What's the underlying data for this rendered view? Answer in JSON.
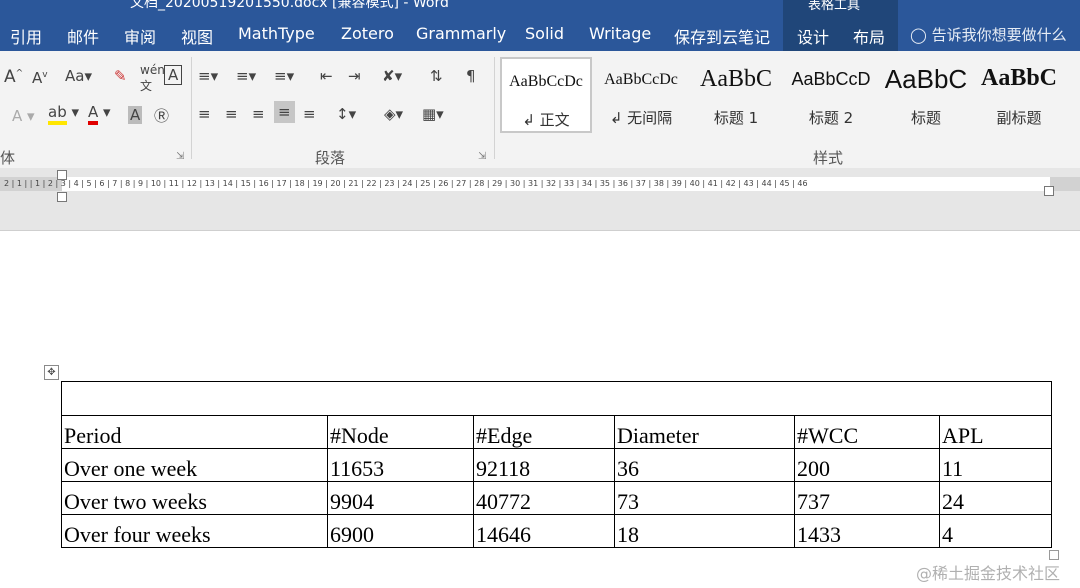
{
  "title_bar": {
    "document_title": "文档_20200519201550.docx [兼容模式] - Word",
    "context_tools": "表格工具"
  },
  "tabs": [
    "引用",
    "邮件",
    "审阅",
    "视图",
    "MathType",
    "Zotero",
    "Grammarly",
    "Solid",
    "Writage",
    "保存到云笔记",
    "设计",
    "布局"
  ],
  "tell_me": "告诉我你想要做什么",
  "ribbon": {
    "font_group_label": "体",
    "paragraph_group_label": "段落",
    "styles_group_label": "样式",
    "styles": [
      {
        "sample": "AaBbCcDc",
        "name": "↲ 正文",
        "selected": true
      },
      {
        "sample": "AaBbCcDc",
        "name": "↲ 无间隔"
      },
      {
        "sample": "AaBbC",
        "name": "标题 1"
      },
      {
        "sample": "AaBbCcD",
        "name": "标题 2"
      },
      {
        "sample": "AaBbC",
        "name": "标题"
      },
      {
        "sample": "AaBbC",
        "name": "副标题"
      }
    ]
  },
  "ruler_text": "2 | 1 |   | 1 | 2 | 3 | 4 | 5 | 6 | 7 | 8 | 9 | 10 | 11 | 12 | 13 | 14 | 15 | 16 | 17 | 18 | 19 | 20 | 21 | 22 | 23 | 24 | 25 | 26 | 27 | 28 | 29 | 30 | 31 | 32 | 33 | 34 | 35 | 36 | 37 | 38 | 39 | 40 | 41 | 42 | 43 | 44 | 45 | 46",
  "table": {
    "headers": [
      "Period",
      "#Node",
      "#Edge",
      "Diameter",
      "#WCC",
      "APL"
    ],
    "rows": [
      [
        "Over one week",
        "11653",
        "92118",
        "36",
        "200",
        "11"
      ],
      [
        "Over two weeks",
        "9904",
        "40772",
        "73",
        "737",
        "24"
      ],
      [
        "Over four weeks",
        "6900",
        "14646",
        "18",
        "1433",
        "4"
      ]
    ]
  },
  "watermark": "@稀土掘金技术社区"
}
